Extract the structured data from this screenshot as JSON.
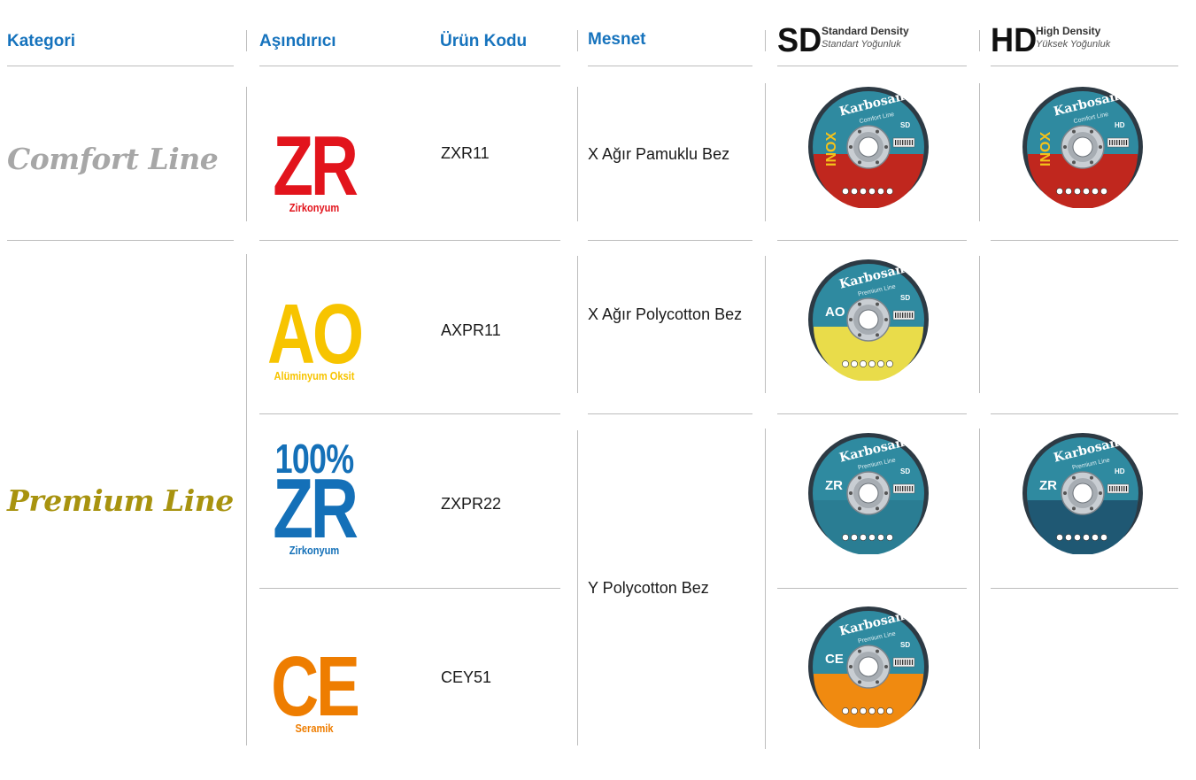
{
  "header": {
    "kategori": "Kategori",
    "asindirici": "Aşındırıcı",
    "urun_kodu": "Ürün Kodu",
    "mesnet": "Mesnet",
    "sd": {
      "abbr": "SD",
      "en": "Standard Density",
      "tr": "Standart Yoğunluk"
    },
    "hd": {
      "abbr": "HD",
      "en": "High Density",
      "tr": "Yüksek Yoğunluk"
    }
  },
  "categories": {
    "comfort": "Comfort Line",
    "premium": "Premium Line"
  },
  "rows": [
    {
      "abrasive_code": "ZR",
      "abrasive_name": "Zirkonyum",
      "abrasive_prefix": "",
      "product_code": "ZXR11",
      "backing": "X Ağır Pamuklu Bez",
      "disc_label": "INOX",
      "disc_line": "Comfort Line"
    },
    {
      "abrasive_code": "AO",
      "abrasive_name": "Alüminyum Oksit",
      "abrasive_prefix": "",
      "product_code": "AXPR11",
      "backing": "X Ağır Polycotton Bez",
      "disc_label": "AO",
      "disc_line": "Premium Line"
    },
    {
      "abrasive_code": "ZR",
      "abrasive_name": "Zirkonyum",
      "abrasive_prefix": "100%",
      "product_code": "ZXPR22",
      "backing": "Y Polycotton Bez",
      "disc_label": "ZR",
      "disc_line": "Premium Line"
    },
    {
      "abrasive_code": "CE",
      "abrasive_name": "Seramik",
      "abrasive_prefix": "",
      "product_code": "CEY51",
      "backing": "",
      "disc_label": "CE",
      "disc_line": "Premium Line"
    }
  ],
  "disc": {
    "brand": "Karbosan",
    "sd_mark": "SD",
    "hd_mark": "HD"
  },
  "colors": {
    "header_blue": "#1673bd",
    "comfort_grey": "#a7a7a7",
    "premium_gold": "#a8930f",
    "zr_red": "#e2141c",
    "ao_yellow": "#f7c400",
    "zr_blue": "#1470b8",
    "ce_orange": "#ee7d00"
  }
}
